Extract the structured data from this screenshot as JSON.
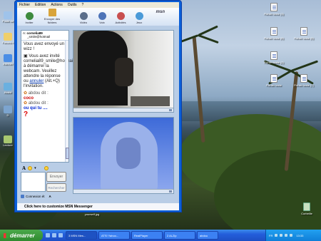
{
  "desktop": {
    "icons_right": [
      {
        "label": "Fichier texte (3)"
      },
      {
        "label": "Fichier texte (6)"
      },
      {
        "label": "Fichier texte (5)"
      },
      {
        "label": "Fichier texte (2)"
      },
      {
        "label": "Fichier texte"
      },
      {
        "label": "Fichier texte (7)"
      }
    ],
    "icons_left": [
      {
        "label": "Poste de"
      },
      {
        "label": "Favoris r"
      },
      {
        "label": "Internet"
      },
      {
        "label": "Assist"
      },
      {
        "label": "D"
      },
      {
        "label": "Lecture"
      }
    ],
    "desktop_item_bottom": "yourself.jpg",
    "recycle_bin": "Corbeille"
  },
  "msn": {
    "menu": [
      "Fichier",
      "Edition",
      "Actions",
      "Outils",
      "?"
    ],
    "toolbar": [
      "Inviter",
      "Envoyer des fichiers",
      "Vidéo",
      "Voix",
      "Activités",
      "Jeux"
    ],
    "logo": "msn",
    "contact": {
      "to_label": "A:",
      "name": "cornelia89",
      "email": "_smile@hotmail"
    },
    "messages": {
      "m1": "Vous avez envoyé un wizz !",
      "m2": "Vous avez invité cornelia89_smile@hotmail.com à démarrer la webcam. Veuillez attendre la réponse ou",
      "m2_cancel": "annuler",
      "m2_tail": "(Alt.+Q) l'invitation.",
      "nick1": "abdou",
      "says": "dit :",
      "msg_coco": "coco",
      "nick2": "abdou",
      "msg_ouquitu": "ou qui tu ....",
      "qmark": "?"
    },
    "send_label": "Envoyer",
    "search_label": "Rechercher",
    "connect_label": "Connexion ét",
    "statusbar": "Click here to customize MSN Messenger"
  },
  "taskbar": {
    "start": "démarrer",
    "tasks": [
      "3 MSN Mes...",
      "ATS! Yahoo...",
      "RealPlayer",
      "2 ALZip",
      "abdou"
    ],
    "lang": "FR",
    "clock": "13:33"
  },
  "colors": {
    "xp_blue": "#0a5fd8",
    "taskbar": "#245edb",
    "start_green": "#2f8a2f"
  }
}
